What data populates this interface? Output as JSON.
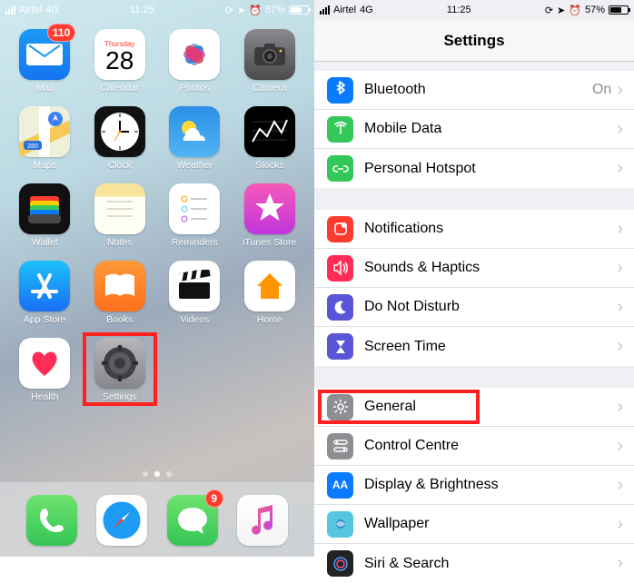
{
  "status": {
    "carrier": "Airtel",
    "network": "4G",
    "time": "11:25",
    "battery_pct": "57%",
    "battery_fill": 57,
    "icons": [
      "orientation-lock",
      "navigation",
      "alarm"
    ]
  },
  "home": {
    "apps": [
      {
        "label": "Mail",
        "icon": "mail",
        "badge": "110"
      },
      {
        "label": "Calendar",
        "icon": "calendar",
        "weekday": "Thursday",
        "day": "28"
      },
      {
        "label": "Photos",
        "icon": "photos"
      },
      {
        "label": "Camera",
        "icon": "camera"
      },
      {
        "label": "Maps",
        "icon": "maps"
      },
      {
        "label": "Clock",
        "icon": "clock"
      },
      {
        "label": "Weather",
        "icon": "weather"
      },
      {
        "label": "Stocks",
        "icon": "stocks"
      },
      {
        "label": "Wallet",
        "icon": "wallet"
      },
      {
        "label": "Notes",
        "icon": "notes"
      },
      {
        "label": "Reminders",
        "icon": "reminders"
      },
      {
        "label": "iTunes Store",
        "icon": "itunes"
      },
      {
        "label": "App Store",
        "icon": "appstore"
      },
      {
        "label": "Books",
        "icon": "books"
      },
      {
        "label": "Videos",
        "icon": "videos"
      },
      {
        "label": "Home",
        "icon": "home"
      },
      {
        "label": "Health",
        "icon": "health"
      },
      {
        "label": "Settings",
        "icon": "settings",
        "highlighted": true
      }
    ],
    "page_dots": {
      "count": 3,
      "active": 1
    },
    "dock": [
      {
        "label": "Phone",
        "icon": "phone"
      },
      {
        "label": "Safari",
        "icon": "safari"
      },
      {
        "label": "Messages",
        "icon": "messages",
        "badge": "9"
      },
      {
        "label": "Music",
        "icon": "music"
      }
    ]
  },
  "settings": {
    "title": "Settings",
    "groups": [
      [
        {
          "label": "Bluetooth",
          "value": "On",
          "icon": "bluetooth",
          "color": "#0a7bff"
        },
        {
          "label": "Mobile Data",
          "icon": "antenna",
          "color": "#34c759"
        },
        {
          "label": "Personal Hotspot",
          "icon": "link",
          "color": "#34c759"
        }
      ],
      [
        {
          "label": "Notifications",
          "icon": "notification",
          "color": "#ff3b30"
        },
        {
          "label": "Sounds & Haptics",
          "icon": "speaker",
          "color": "#ff2d55"
        },
        {
          "label": "Do Not Disturb",
          "icon": "moon",
          "color": "#5856d6"
        },
        {
          "label": "Screen Time",
          "icon": "hourglass",
          "color": "#5856d6"
        }
      ],
      [
        {
          "label": "General",
          "icon": "gear",
          "color": "#8e8e93",
          "highlighted": true
        },
        {
          "label": "Control Centre",
          "icon": "switches",
          "color": "#8e8e93"
        },
        {
          "label": "Display & Brightness",
          "icon": "aa",
          "color": "#0a7bff"
        },
        {
          "label": "Wallpaper",
          "icon": "wallpaper",
          "color": "#54c6de"
        },
        {
          "label": "Siri & Search",
          "icon": "siri",
          "color": "#222"
        }
      ]
    ]
  }
}
